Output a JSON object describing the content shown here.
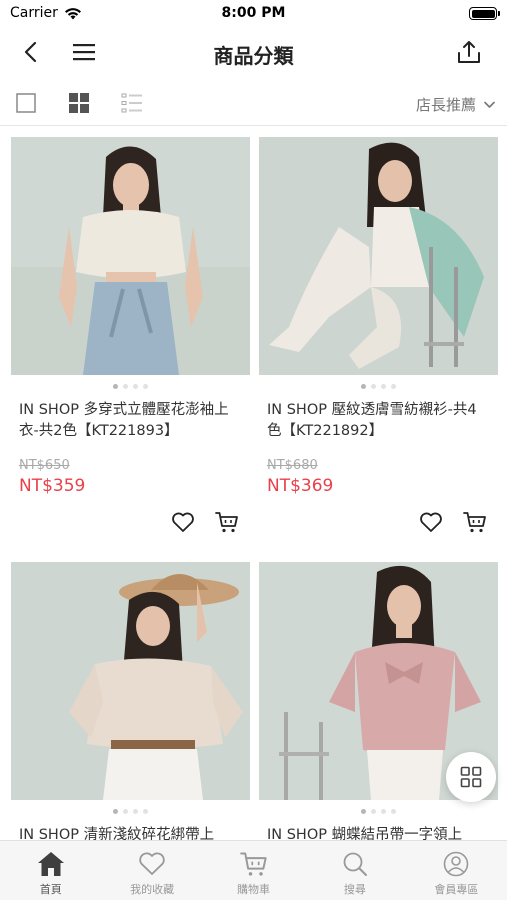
{
  "status_bar": {
    "carrier": "Carrier",
    "time": "8:00 PM"
  },
  "nav": {
    "title": "商品分類"
  },
  "toolbar": {
    "sort_label": "店長推薦"
  },
  "products": [
    {
      "name": "IN SHOP 多穿式立體壓花澎袖上衣-共2色【KT221893】",
      "original_price": "NT$650",
      "price": "NT$359"
    },
    {
      "name": "IN SHOP 壓紋透膚雪紡襯衫-共4色【KT221892】",
      "original_price": "NT$680",
      "price": "NT$369"
    },
    {
      "name": "IN SHOP 清新淺紋碎花綁帶上",
      "original_price": "",
      "price": ""
    },
    {
      "name": "IN SHOP 蝴蝶結吊帶一字領上",
      "original_price": "",
      "price": ""
    }
  ],
  "tabbar": {
    "home": "首頁",
    "favorites": "我的收藏",
    "cart": "購物車",
    "search": "搜尋",
    "member": "會員專區"
  },
  "colors": {
    "sale_price": "#e8414a",
    "accent_dark": "#333333"
  }
}
